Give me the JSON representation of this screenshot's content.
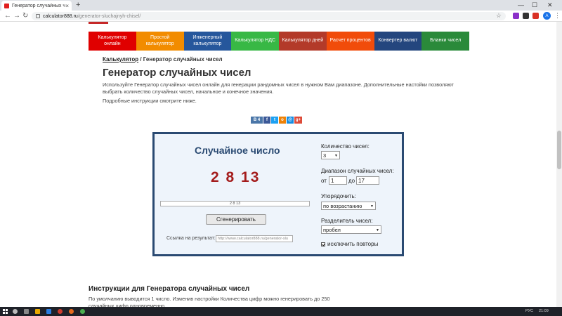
{
  "browser": {
    "tab_title": "Генератор случайных чисел",
    "tab_close": "×",
    "new_tab": "+",
    "url_host": "calculator888.ru",
    "url_path": "/generator-sluchajnyh-chisel/",
    "window_controls": [
      "—",
      "☐",
      "✕"
    ]
  },
  "nav": {
    "items": [
      {
        "label": "Калькулятор онлайн",
        "color": "#e00000"
      },
      {
        "label": "Простой калькулятор",
        "color": "#f28c00"
      },
      {
        "label": "Инженерный калькулятор",
        "color": "#26579c"
      },
      {
        "label": "Калькулятор НДС",
        "color": "#38b845"
      },
      {
        "label": "Калькулятор дней",
        "color": "#b33a29"
      },
      {
        "label": "Расчет процентов",
        "color": "#f14c0a"
      },
      {
        "label": "Конвертер валют",
        "color": "#24467e"
      },
      {
        "label": "Бланки чисел",
        "color": "#2a8a3a"
      }
    ]
  },
  "breadcrumb": {
    "home": "Калькулятор",
    "separator": " / ",
    "current": "Генератор случайных чисел"
  },
  "page": {
    "title": "Генератор случайных чисел",
    "intro": "Используйте Генератор случайных чисел онлайн для генерации рандомных чисел в нужном Вам диапазоне. Дополнительные настойки позволяют выбрать количество случайных чисел, начальное и конечное значения.",
    "hint": "Подробные инструкции смотрите ниже."
  },
  "share": {
    "buttons": [
      {
        "label": "В 4",
        "color": "#4a76a8"
      },
      {
        "label": "f",
        "color": "#3b5998"
      },
      {
        "label": "t",
        "color": "#1da1f2"
      },
      {
        "label": "о",
        "color": "#ee8208"
      },
      {
        "label": "@",
        "color": "#168de2"
      },
      {
        "label": "g+",
        "color": "#dd4b39"
      }
    ]
  },
  "generator": {
    "title": "Случайное число",
    "result": "2 8 13",
    "result_field": "2 8 13",
    "button": "Сгенерировать",
    "link_label": "Ссылка на результат:",
    "link_value": "http://www.calculator888.ru/generator-slu",
    "count_label": "Количество чисел:",
    "count_value": "3",
    "range_label": "Диапазон случайных чисел:",
    "range_from_label": "от",
    "range_from": "1",
    "range_to_label": "до",
    "range_to": "17",
    "sort_label": "Упорядочить:",
    "sort_value": "по возрастанию",
    "separator_label": "Разделитель чисел:",
    "separator_value": "пробел",
    "no_repeat_label": "исключить повторы",
    "no_repeat_checked": true
  },
  "instructions": {
    "title": "Инструкции для Генератора случайных чисел",
    "text": "По умолчанию выводится 1 число. Изменив настройки Количества цифр можно генерировать до 250 случайных цифр одновременно."
  },
  "taskbar": {
    "lang": "РУС",
    "time": "21:09"
  }
}
